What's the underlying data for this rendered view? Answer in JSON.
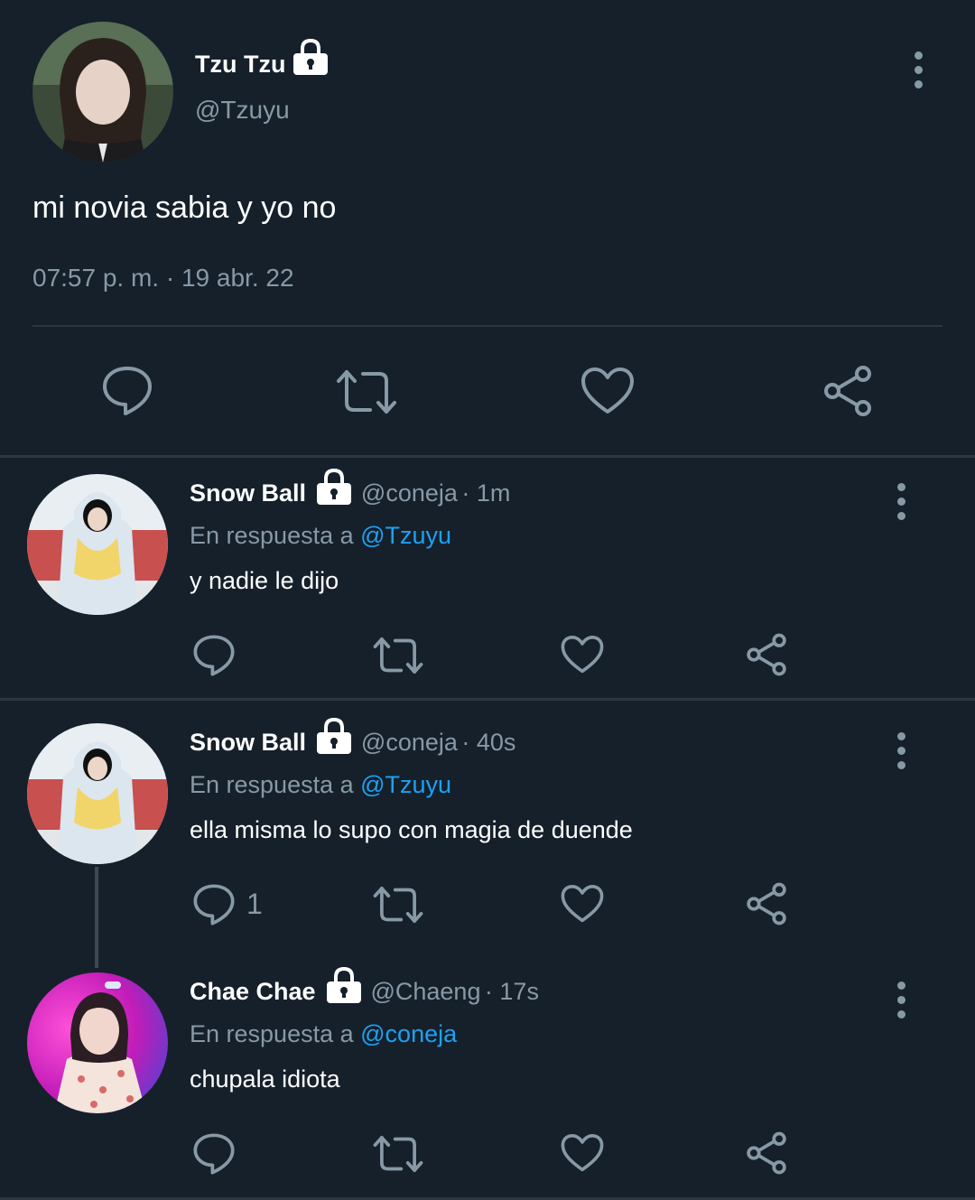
{
  "main_tweet": {
    "display_name": "Tzu Tzu",
    "handle": "@Tzuyu",
    "text": "mi novia sabia y yo no",
    "timestamp": "07:57 p. m. · 19 abr. 22",
    "actions": [
      "reply-icon",
      "retweet-icon",
      "like-icon",
      "share-icon"
    ]
  },
  "replies": [
    {
      "display_name": "Snow Ball",
      "handle": "@coneja",
      "time": "· 1m",
      "reply_prefix": "En respuesta a",
      "reply_to": "@Tzuyu",
      "text": "y nadie le dijo",
      "reply_count": ""
    },
    {
      "display_name": "Snow Ball",
      "handle": "@coneja",
      "time": "· 40s",
      "reply_prefix": "En respuesta a",
      "reply_to": "@Tzuyu",
      "text": "ella misma lo supo con magia de duende",
      "reply_count": "1"
    },
    {
      "display_name": "Chae Chae",
      "handle": "@Chaeng",
      "time": "· 17s",
      "reply_prefix": "En respuesta a",
      "reply_to": "@coneja",
      "text": "chupala idiota",
      "reply_count": ""
    }
  ],
  "colors": {
    "background": "#15202b",
    "muted": "#8899a6",
    "link": "#1da1f2",
    "divider": "#2b3640"
  }
}
